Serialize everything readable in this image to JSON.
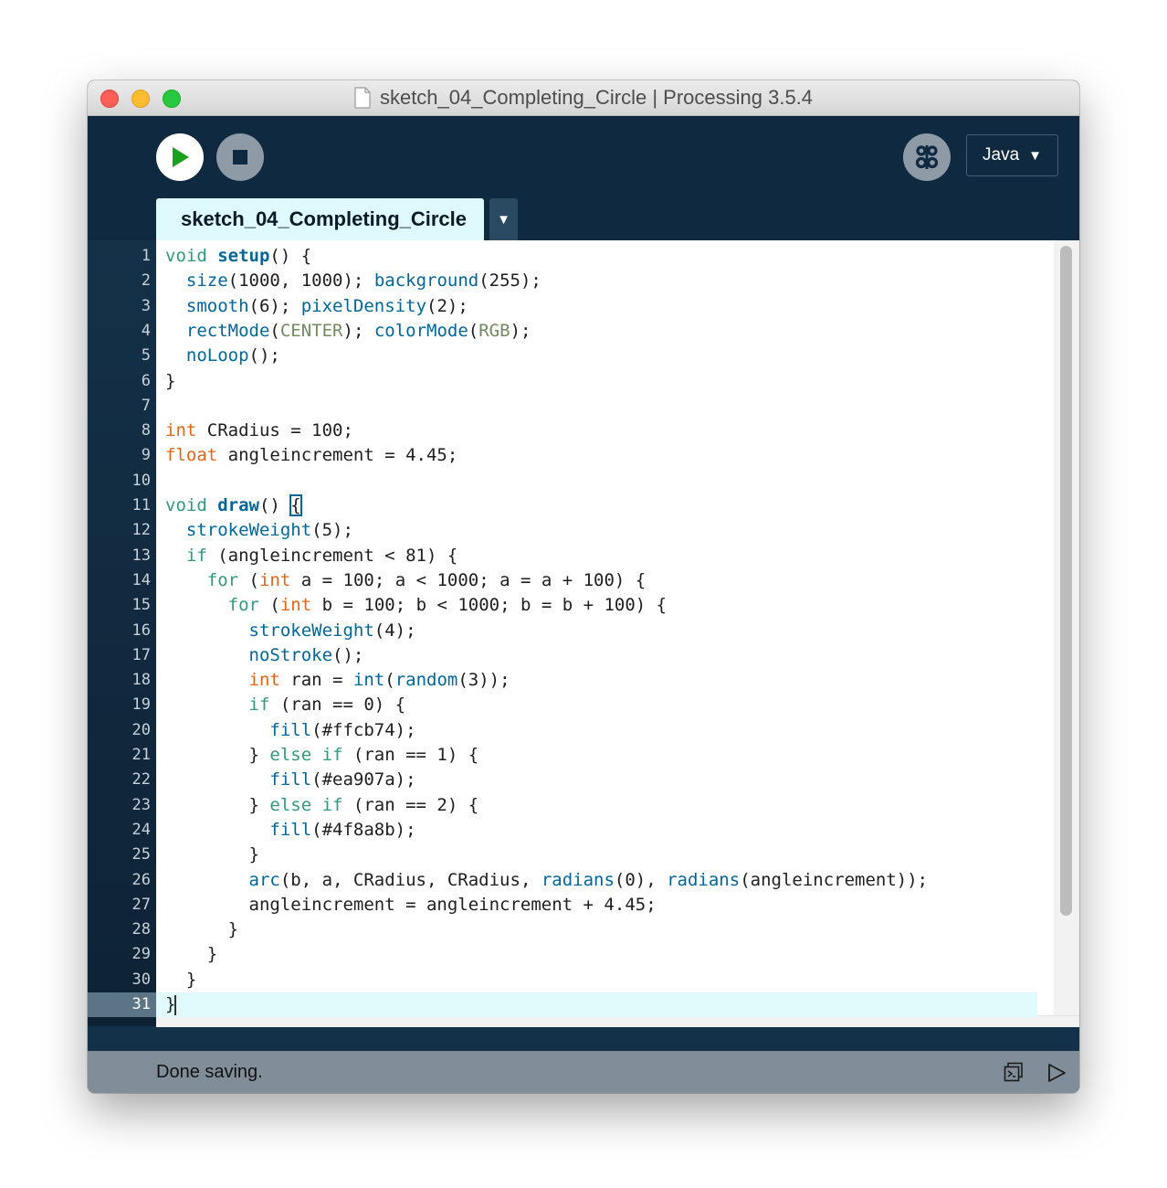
{
  "window": {
    "title": "sketch_04_Completing_Circle | Processing 3.5.4"
  },
  "toolbar": {
    "run_icon": "play-icon",
    "stop_icon": "stop-icon",
    "debug_icon": "butterfly-debug-icon",
    "mode_label": "Java",
    "mode_arrow": "▼"
  },
  "tabs": {
    "active_label": "sketch_04_Completing_Circle",
    "menu_arrow": "▼"
  },
  "editor": {
    "line_numbers": [
      "1",
      "2",
      "3",
      "4",
      "5",
      "6",
      "7",
      "8",
      "9",
      "10",
      "11",
      "12",
      "13",
      "14",
      "15",
      "16",
      "17",
      "18",
      "19",
      "20",
      "21",
      "22",
      "23",
      "24",
      "25",
      "26",
      "27",
      "28",
      "29",
      "30",
      "31"
    ],
    "active_line": 31,
    "lines": [
      [
        {
          "t": "void ",
          "c": "kw"
        },
        {
          "t": "setup",
          "c": "fn bold"
        },
        {
          "t": "() {",
          "c": ""
        }
      ],
      [
        {
          "t": "  ",
          "c": ""
        },
        {
          "t": "size",
          "c": "fn"
        },
        {
          "t": "(1000, 1000); ",
          "c": ""
        },
        {
          "t": "background",
          "c": "fn"
        },
        {
          "t": "(255);",
          "c": ""
        }
      ],
      [
        {
          "t": "  ",
          "c": ""
        },
        {
          "t": "smooth",
          "c": "fn"
        },
        {
          "t": "(6); ",
          "c": ""
        },
        {
          "t": "pixelDensity",
          "c": "fn"
        },
        {
          "t": "(2);",
          "c": ""
        }
      ],
      [
        {
          "t": "  ",
          "c": ""
        },
        {
          "t": "rectMode",
          "c": "fn"
        },
        {
          "t": "(",
          "c": ""
        },
        {
          "t": "CENTER",
          "c": "cst"
        },
        {
          "t": "); ",
          "c": ""
        },
        {
          "t": "colorMode",
          "c": "fn"
        },
        {
          "t": "(",
          "c": ""
        },
        {
          "t": "RGB",
          "c": "cst"
        },
        {
          "t": ");",
          "c": ""
        }
      ],
      [
        {
          "t": "  ",
          "c": ""
        },
        {
          "t": "noLoop",
          "c": "fn"
        },
        {
          "t": "();",
          "c": ""
        }
      ],
      [
        {
          "t": "}",
          "c": ""
        }
      ],
      [],
      [
        {
          "t": "int",
          "c": "typ"
        },
        {
          "t": " CRadius = 100;",
          "c": ""
        }
      ],
      [
        {
          "t": "float",
          "c": "typ"
        },
        {
          "t": " angleincrement = 4.45;",
          "c": ""
        }
      ],
      [],
      [
        {
          "t": "void ",
          "c": "kw"
        },
        {
          "t": "draw",
          "c": "fn bold"
        },
        {
          "t": "() ",
          "c": ""
        },
        {
          "t": "{",
          "c": "bracket"
        }
      ],
      [
        {
          "t": "  ",
          "c": ""
        },
        {
          "t": "strokeWeight",
          "c": "fn"
        },
        {
          "t": "(5);",
          "c": ""
        }
      ],
      [
        {
          "t": "  ",
          "c": ""
        },
        {
          "t": "if",
          "c": "kw"
        },
        {
          "t": " (angleincrement < 81) {",
          "c": ""
        }
      ],
      [
        {
          "t": "    ",
          "c": ""
        },
        {
          "t": "for",
          "c": "kw"
        },
        {
          "t": " (",
          "c": ""
        },
        {
          "t": "int",
          "c": "typ"
        },
        {
          "t": " a = 100; a < 1000; a = a + 100) {",
          "c": ""
        }
      ],
      [
        {
          "t": "      ",
          "c": ""
        },
        {
          "t": "for",
          "c": "kw"
        },
        {
          "t": " (",
          "c": ""
        },
        {
          "t": "int",
          "c": "typ"
        },
        {
          "t": " b = 100; b < 1000; b = b + 100) {",
          "c": ""
        }
      ],
      [
        {
          "t": "        ",
          "c": ""
        },
        {
          "t": "strokeWeight",
          "c": "fn"
        },
        {
          "t": "(4);",
          "c": ""
        }
      ],
      [
        {
          "t": "        ",
          "c": ""
        },
        {
          "t": "noStroke",
          "c": "fn"
        },
        {
          "t": "();",
          "c": ""
        }
      ],
      [
        {
          "t": "        ",
          "c": ""
        },
        {
          "t": "int",
          "c": "typ"
        },
        {
          "t": " ran = ",
          "c": ""
        },
        {
          "t": "int",
          "c": "fn"
        },
        {
          "t": "(",
          "c": ""
        },
        {
          "t": "random",
          "c": "fn"
        },
        {
          "t": "(3));",
          "c": ""
        }
      ],
      [
        {
          "t": "        ",
          "c": ""
        },
        {
          "t": "if",
          "c": "kw"
        },
        {
          "t": " (ran == 0) {",
          "c": ""
        }
      ],
      [
        {
          "t": "          ",
          "c": ""
        },
        {
          "t": "fill",
          "c": "fn"
        },
        {
          "t": "(#ffcb74);",
          "c": ""
        }
      ],
      [
        {
          "t": "        } ",
          "c": ""
        },
        {
          "t": "else if",
          "c": "kw"
        },
        {
          "t": " (ran == 1) {",
          "c": ""
        }
      ],
      [
        {
          "t": "          ",
          "c": ""
        },
        {
          "t": "fill",
          "c": "fn"
        },
        {
          "t": "(#ea907a);",
          "c": ""
        }
      ],
      [
        {
          "t": "        } ",
          "c": ""
        },
        {
          "t": "else if",
          "c": "kw"
        },
        {
          "t": " (ran == 2) {",
          "c": ""
        }
      ],
      [
        {
          "t": "          ",
          "c": ""
        },
        {
          "t": "fill",
          "c": "fn"
        },
        {
          "t": "(#4f8a8b);",
          "c": ""
        }
      ],
      [
        {
          "t": "        }",
          "c": ""
        }
      ],
      [
        {
          "t": "        ",
          "c": ""
        },
        {
          "t": "arc",
          "c": "fn"
        },
        {
          "t": "(b, a, CRadius, CRadius, ",
          "c": ""
        },
        {
          "t": "radians",
          "c": "fn"
        },
        {
          "t": "(0), ",
          "c": ""
        },
        {
          "t": "radians",
          "c": "fn"
        },
        {
          "t": "(angleincrement));",
          "c": ""
        }
      ],
      [
        {
          "t": "        angleincrement = angleincrement + 4.45;",
          "c": ""
        }
      ],
      [
        {
          "t": "      }",
          "c": ""
        }
      ],
      [
        {
          "t": "    }",
          "c": ""
        }
      ],
      [
        {
          "t": "  }",
          "c": ""
        }
      ],
      [
        {
          "t": "}",
          "c": ""
        }
      ]
    ]
  },
  "status": {
    "message": "Done saving.",
    "console_icon": "console-toggle-icon",
    "expand_icon": "expand-console-icon"
  }
}
